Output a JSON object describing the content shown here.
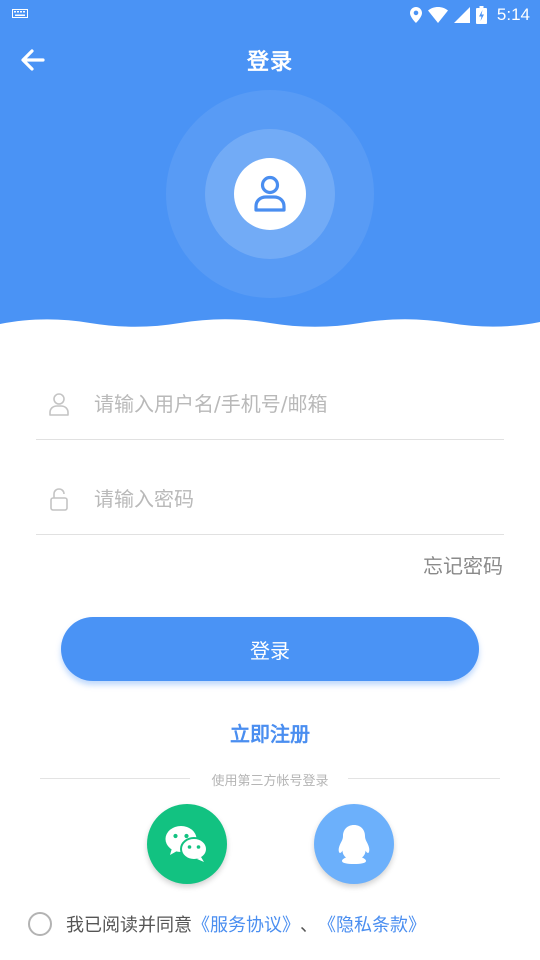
{
  "status_bar": {
    "time": "5:14",
    "icons": [
      "keyboard-icon",
      "location-icon",
      "wifi-icon",
      "signal-icon",
      "battery-charging-icon"
    ]
  },
  "header": {
    "title": "登录",
    "back_icon": "back-arrow-icon",
    "avatar_icon": "user-icon",
    "background_color": "#4a93f5"
  },
  "form": {
    "username": {
      "placeholder": "请输入用户名/手机号/邮箱",
      "value": "",
      "icon": "user-outline-icon"
    },
    "password": {
      "placeholder": "请输入密码",
      "value": "",
      "icon": "lock-icon"
    },
    "forgot_label": "忘记密码",
    "login_label": "登录",
    "register_label": "立即注册"
  },
  "third_party": {
    "label": "使用第三方帐号登录",
    "providers": [
      {
        "icon": "wechat-icon",
        "color": "#12c281"
      },
      {
        "icon": "qq-icon",
        "color": "#6cb0fb"
      }
    ]
  },
  "agreement": {
    "checked": false,
    "prefix": "我已阅读并同意",
    "terms_label": "《服务协议》",
    "separator": "、",
    "privacy_label": "《隐私条款》",
    "link_color": "#4a8ef0"
  }
}
